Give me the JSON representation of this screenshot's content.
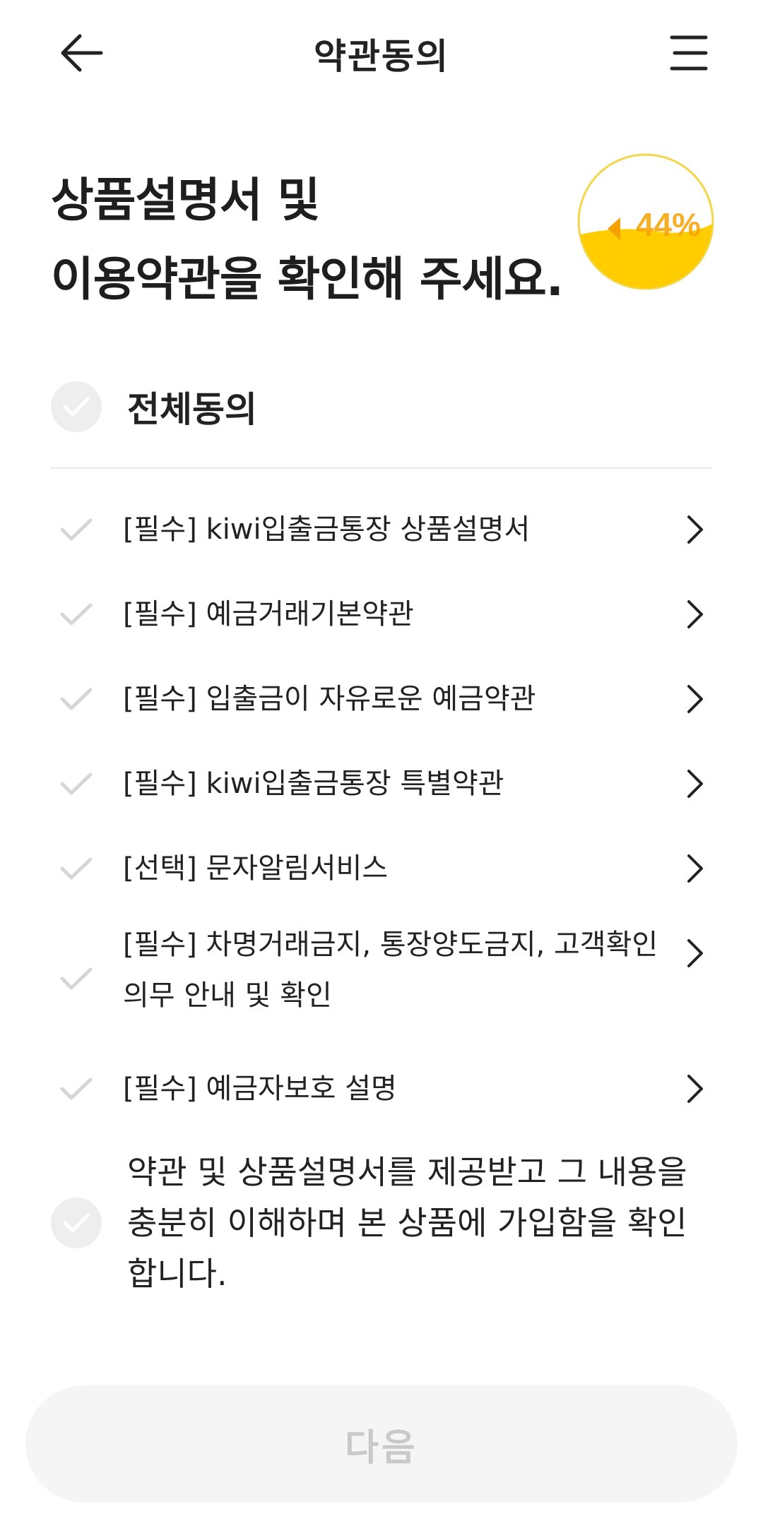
{
  "header": {
    "title": "약관동의",
    "back_icon": "arrow-left-icon",
    "menu_icon": "menu-icon"
  },
  "headline": {
    "line1": "상품설명서 및",
    "line2": "이용약관을 확인해 주세요."
  },
  "progress": {
    "percent": 44,
    "label": "44%",
    "colors": {
      "fill": "#FFCC00",
      "ring": "#F2D64B",
      "text": "#F5A100"
    }
  },
  "agree_all": {
    "label": "전체동의",
    "checked": false
  },
  "terms": [
    {
      "label": "[필수]  kiwi입출금통장 상품설명서",
      "checked": false
    },
    {
      "label": "[필수]  예금거래기본약관",
      "checked": false
    },
    {
      "label": "[필수]  입출금이 자유로운 예금약관",
      "checked": false
    },
    {
      "label": "[필수]  kiwi입출금통장 특별약관",
      "checked": false
    },
    {
      "label": "[선택] 문자알림서비스",
      "checked": false
    },
    {
      "label": "[필수]  차명거래금지, 통장양도금지, 고객확인의무 안내 및 확인",
      "checked": false
    },
    {
      "label": "[필수]  예금자보호 설명",
      "checked": false
    }
  ],
  "confirm": {
    "label": "약관 및 상품설명서를 제공받고 그 내용을 충분히 이해하며 본 상품에 가입함을 확인합니다.",
    "checked": false
  },
  "next_button": {
    "label": "다음",
    "enabled": false
  },
  "colors": {
    "check_inactive": "#D6D6D6",
    "check_bg": "#EEEEEE",
    "button_bg": "#F5F5F5",
    "button_text": "#C9C9C9",
    "text": "#222222"
  }
}
